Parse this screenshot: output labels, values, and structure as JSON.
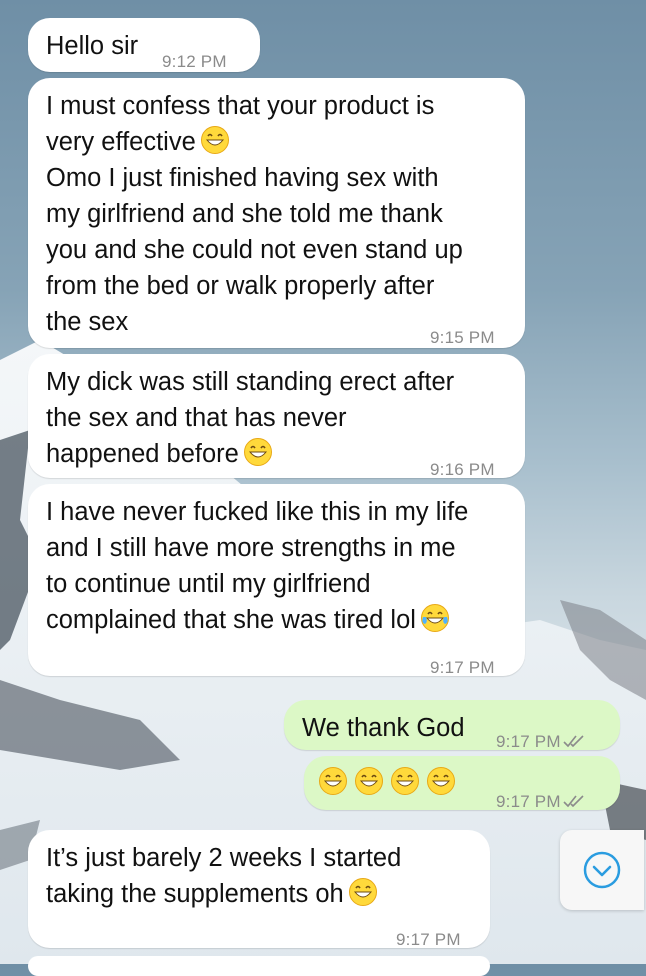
{
  "messages": [
    {
      "text": "Hello sir",
      "time": "9:12 PM"
    },
    {
      "text_lines": [
        "I must confess that your product is",
        "very effective",
        "Omo I just finished having sex with",
        "my girlfriend and she told me thank",
        "you and she could not even stand up",
        "from the bed or walk properly after",
        "the sex"
      ],
      "emoji": "grinning-face-icon",
      "time": "9:15 PM"
    },
    {
      "text_lines": [
        "My dick was still standing erect after",
        "the sex and that has never",
        "happened before"
      ],
      "emoji": "grinning-face-icon",
      "time": "9:16 PM"
    },
    {
      "text_lines": [
        "I have never fucked like this in my life",
        "and I still have more strengths in me",
        "to continue until my girlfriend",
        "complained that she was tired lol"
      ],
      "emoji": "tears-of-joy-icon",
      "time": "9:17 PM"
    },
    {
      "text": "We thank God",
      "time": "9:17 PM",
      "status": "read-ticks-icon"
    },
    {
      "emojis": [
        "grinning-face-icon",
        "grinning-face-icon",
        "grinning-face-icon",
        "grinning-face-icon"
      ],
      "time": "9:17 PM",
      "status": "read-ticks-icon"
    },
    {
      "text_lines": [
        "It’s just barely 2 weeks I started",
        "taking the supplements oh"
      ],
      "emoji": "grinning-face-icon",
      "time": "9:17 PM"
    }
  ],
  "scroll_button": {
    "icon": "chevron-down-icon"
  },
  "colors": {
    "incoming": "#ffffff",
    "outgoing": "#dcf8c6",
    "accent": "#2a9ce0",
    "time": "#8b8b8b"
  }
}
